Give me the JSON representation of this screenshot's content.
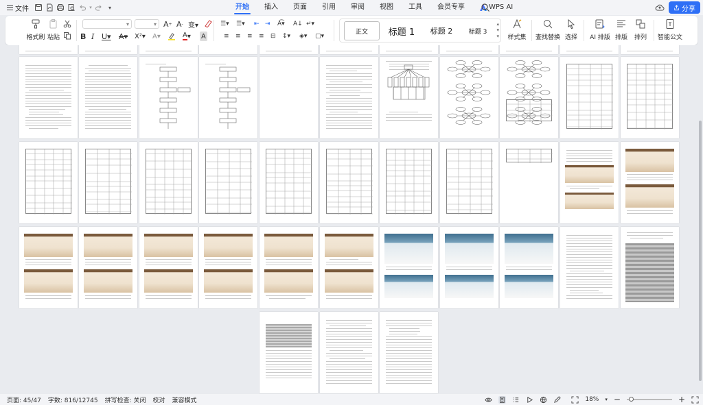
{
  "menubar": {
    "file_label": "文件",
    "tabs": [
      {
        "label": "开始",
        "active": true
      },
      {
        "label": "插入"
      },
      {
        "label": "页面"
      },
      {
        "label": "引用"
      },
      {
        "label": "审阅"
      },
      {
        "label": "视图"
      },
      {
        "label": "工具"
      },
      {
        "label": "会员专享"
      }
    ],
    "ai_tab_label": "WPS AI",
    "share_label": "分享",
    "accent_color": "#2e6ff6"
  },
  "ribbon": {
    "format_painter": "格式刷",
    "paste": "粘贴",
    "styles": [
      "正文",
      "标题 1",
      "标题 2",
      "标题 3"
    ],
    "style_set": "样式集",
    "find_replace": "查找替换",
    "select": "选择",
    "ai_layout": "AI 排版",
    "layout": "排版",
    "arrange": "排列",
    "smart_doc": "智能公文"
  },
  "statusbar": {
    "page": "页面: 45/47",
    "words": "字数: 816/12745",
    "spell": "拼写检查: 关闭",
    "proof": "校对",
    "compat": "兼容模式",
    "zoom": "18%"
  }
}
